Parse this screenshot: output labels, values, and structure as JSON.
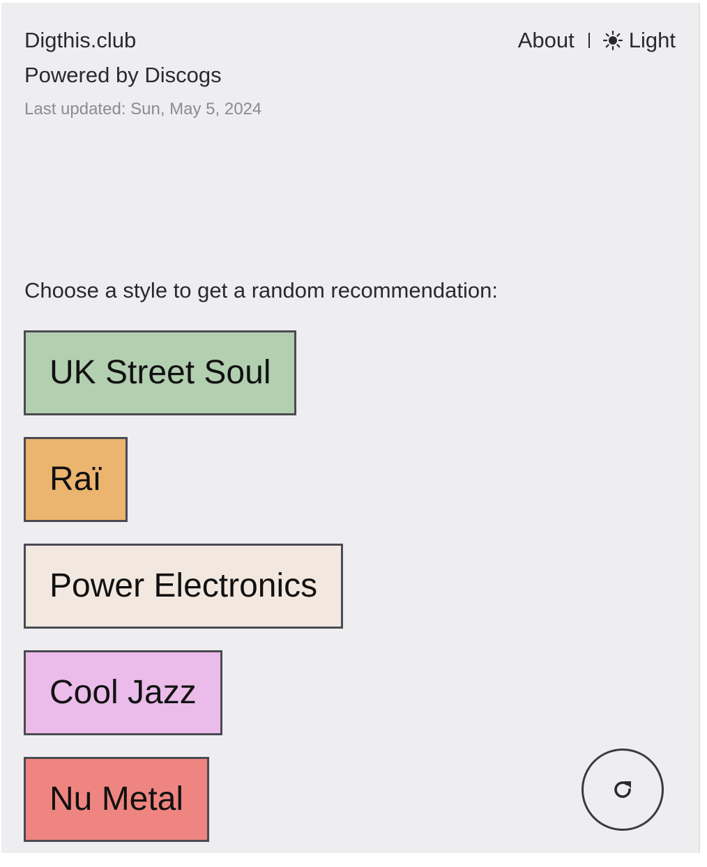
{
  "header": {
    "brand": "Digthis.club",
    "powered_by": "Powered by Discogs",
    "last_updated": "Last updated: Sun, May 5, 2024"
  },
  "nav": {
    "about_label": "About",
    "theme_label": "Light",
    "theme_icon": "sun-icon"
  },
  "main": {
    "prompt": "Choose a style to get a random recommendation:",
    "styles": [
      {
        "label": "UK Street Soul",
        "color": "#b2cfb0"
      },
      {
        "label": "Raï",
        "color": "#ebb46f"
      },
      {
        "label": "Power Electronics",
        "color": "#f2e8df"
      },
      {
        "label": "Cool Jazz",
        "color": "#ebbbea"
      },
      {
        "label": "Nu Metal",
        "color": "#ef8580"
      }
    ]
  },
  "refresh_button": {
    "icon": "refresh-icon"
  }
}
